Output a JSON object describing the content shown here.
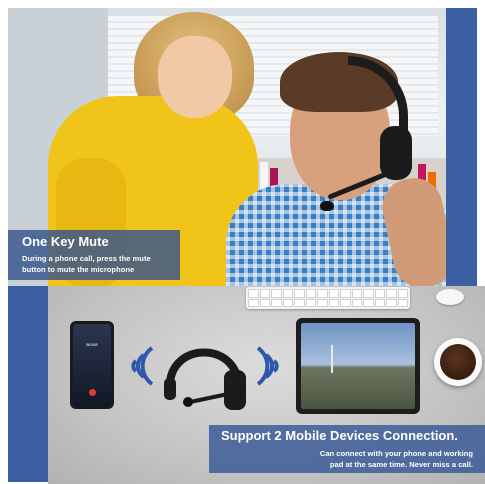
{
  "mute_feature": {
    "title": "One Key Mute",
    "description_line1": "During a phone call, press the mute",
    "description_line2": "button to mute the microphone"
  },
  "connection_feature": {
    "title": "Support 2 Mobile Devices Connection.",
    "description_line1": "Can connect with your phone and working",
    "description_line2": "pad at the same time. Never miss a call."
  },
  "phone_screen": {
    "caller": "BOSS"
  },
  "colors": {
    "brand_blue": "#3b5fa0",
    "caption_blue": "#36548c",
    "shirt_yellow": "#f0c419",
    "headset_black": "#1b1b1b",
    "end_call_red": "#e53935",
    "wave_blue": "#2f58a8"
  },
  "icons": [
    "bluetooth-wave-icon",
    "end-call-icon"
  ]
}
